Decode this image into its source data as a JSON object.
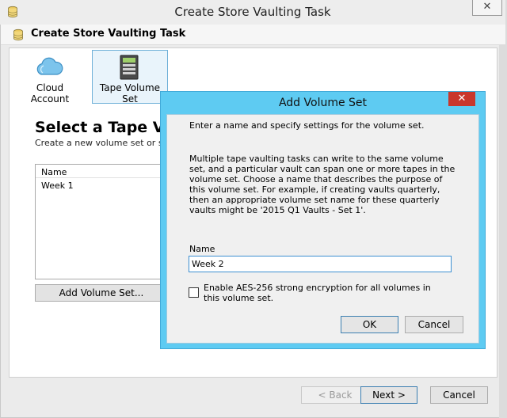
{
  "window": {
    "title": "Create Store Vaulting Task",
    "header": "Create Store Vaulting Task",
    "close_glyph": "✕"
  },
  "tabs": [
    {
      "label": "Cloud Account",
      "icon": "cloud-icon"
    },
    {
      "label": "Tape Volume Set",
      "icon": "tape-library-icon"
    }
  ],
  "page": {
    "title": "Select a Tape Vo",
    "subtitle": "Create a new volume set or sele",
    "list_header": "Name",
    "list_items": [
      "Week 1"
    ],
    "add_button": "Add Volume Set..."
  },
  "footer": {
    "back": "< Back",
    "next": "Next >",
    "cancel": "Cancel"
  },
  "dialog": {
    "title": "Add Volume Set",
    "close_glyph": "✕",
    "intro": "Enter a name and specify settings for the volume set.",
    "description": "Multiple tape vaulting tasks can write to the same volume set, and a particular vault can span one or more tapes in the volume set. Choose a name that describes the purpose of this volume set. For example, if creating vaults quarterly, then an appropriate volume set name for these quarterly vaults might be '2015 Q1 Vaults - Set 1'.",
    "name_label": "Name",
    "name_value": "Week 2",
    "encrypt_label": "Enable AES-256 strong encryption for all volumes in this volume set.",
    "encrypt_checked": false,
    "ok": "OK",
    "cancel": "Cancel"
  },
  "colors": {
    "dialog_frame": "#5ecbf2",
    "close_red": "#c9372c",
    "selection_blue": "#6fb0d8"
  }
}
